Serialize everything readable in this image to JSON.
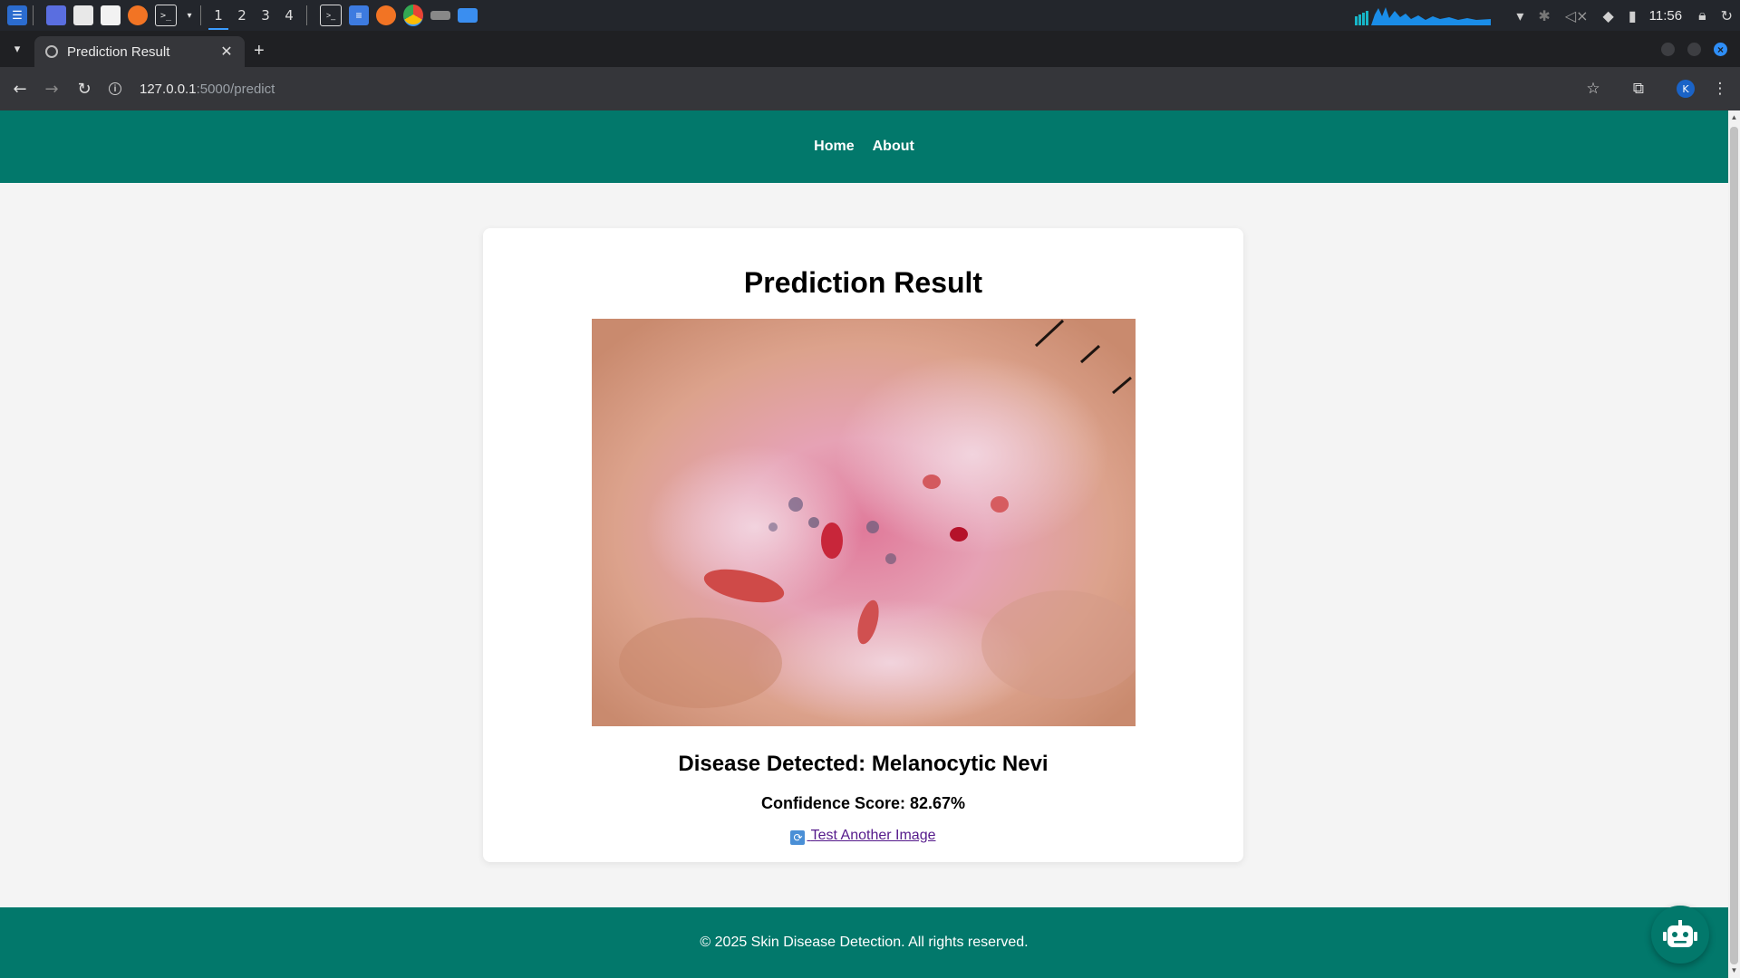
{
  "os": {
    "workspaces": [
      "1",
      "2",
      "3",
      "4"
    ],
    "active_workspace": "1",
    "clock": "11:56"
  },
  "browser": {
    "tab_title": "Prediction Result",
    "url_host": "127.0.0.1",
    "url_rest": ":5000/predict",
    "profile_initial": "K"
  },
  "page": {
    "nav": {
      "home": "Home",
      "about": "About"
    },
    "title": "Prediction Result",
    "disease_text": "Disease Detected: Melanocytic Nevi",
    "confidence_text": "Confidence Score: 82.67%",
    "retry_link": "Test Another Image",
    "footer": "© 2025 Skin Disease Detection. All rights reserved."
  },
  "colors": {
    "brand": "#02786b",
    "link_visited": "#551a8b",
    "accent": "#2e8ef7"
  }
}
